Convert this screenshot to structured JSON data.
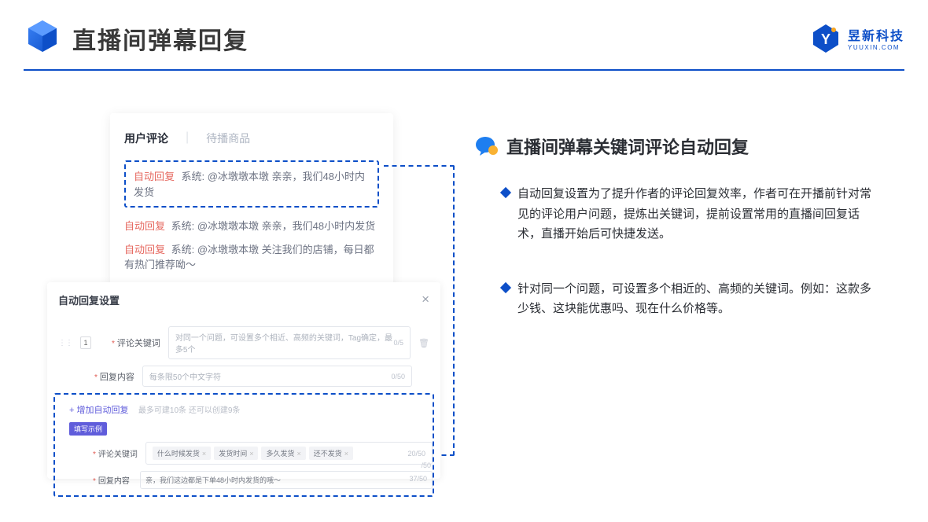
{
  "header": {
    "title": "直播间弹幕回复",
    "logo_cn": "昱新科技",
    "logo_en": "YUUXIN.COM"
  },
  "comments_card": {
    "tabs": {
      "active": "用户评论",
      "inactive": "待播商品"
    },
    "highlighted": {
      "prefix": "自动回复",
      "text": "系统: @冰墩墩本墩 亲亲，我们48小时内发货"
    },
    "line2": {
      "prefix": "自动回复",
      "text": "系统: @冰墩墩本墩 亲亲，我们48小时内发货"
    },
    "line3": {
      "prefix": "自动回复",
      "text": "系统: @冰墩墩本墩 关注我们的店铺，每日都有热门推荐呦～"
    }
  },
  "settings": {
    "title": "自动回复设置",
    "index": "1",
    "field1_label": "评论关键词",
    "field1_placeholder": "对同一个问题，可设置多个相近、高频的关键词，Tag确定，最多5个",
    "field1_counter": "0/5",
    "field2_label": "回复内容",
    "field2_placeholder": "每条限50个中文字符",
    "field2_counter": "0/50",
    "add_text": "+ 增加自动回复",
    "hint": "最多可建10条 还可以创建9条",
    "example_badge": "填写示例",
    "ex_field1_label": "评论关键词",
    "ex_tags": [
      "什么时候发货",
      "发货时间",
      "多久发货",
      "还不发货"
    ],
    "ex_field1_counter": "20/50",
    "ex_field2_label": "回复内容",
    "ex_field2_value": "亲，我们这边都是下单48小时内发货的哦～",
    "ex_field2_counter": "37/50",
    "overflow_count": "/50"
  },
  "right": {
    "subtitle": "直播间弹幕关键词评论自动回复",
    "b1": "自动回复设置为了提升作者的评论回复效率，作者可在开播前针对常见的评论用户问题，提炼出关键词，提前设置常用的直播间回复话术，直播开始后可快捷发送。",
    "b2": "针对同一个问题，可设置多个相近的、高频的关键词。例如：这款多少钱、这块能优惠吗、现在什么价格等。"
  }
}
